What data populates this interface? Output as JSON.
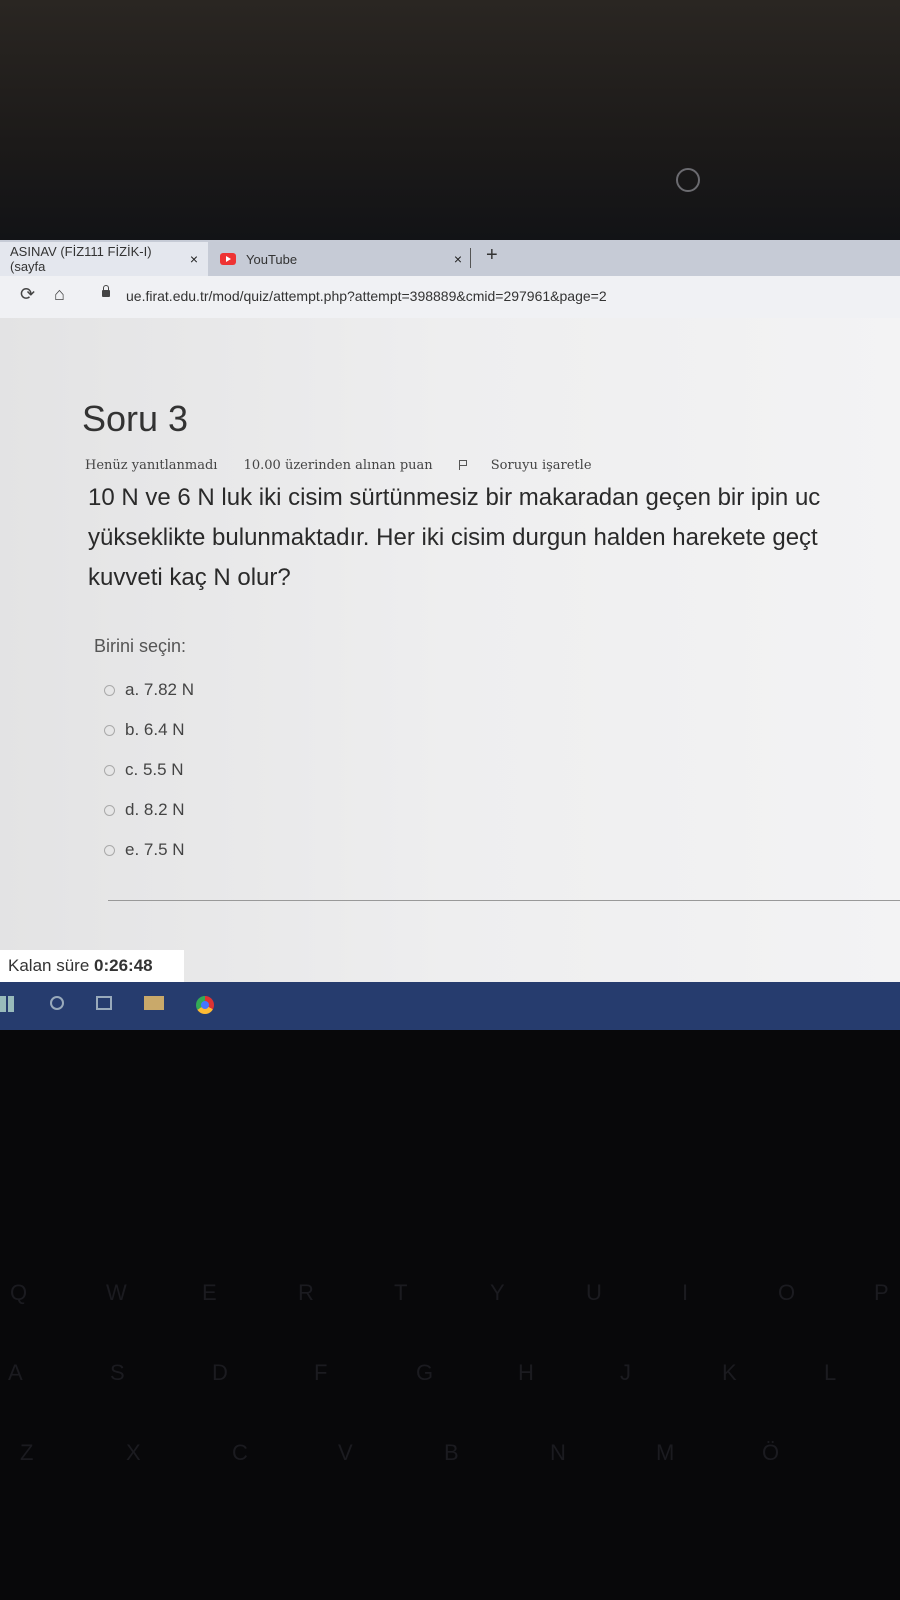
{
  "browser": {
    "tabs": [
      {
        "title": "ASINAV (FİZ111 FİZİK-I) (sayfa",
        "close": "×"
      },
      {
        "title": "YouTube",
        "close": "×"
      }
    ],
    "new_tab": "+",
    "url": "ue.firat.edu.tr/mod/quiz/attempt.php?attempt=398889&cmid=297961&page=2"
  },
  "question": {
    "title": "Soru 3",
    "status": "Henüz yanıtlanmadı",
    "points": "10.00 üzerinden alınan puan",
    "flag_label": "Soruyu işaretle",
    "text_lines": [
      "10 N ve 6 N luk iki cisim sürtünmesiz bir makaradan geçen bir ipin uc",
      "yükseklikte bulunmaktadır. Her iki cisim durgun halden harekete geçt",
      "kuvveti kaç N olur?"
    ],
    "prompt": "Birini seçin:",
    "options": [
      "a. 7.82 N",
      "b. 6.4 N",
      "c. 5.5 N",
      "d. 8.2 N",
      "e. 7.5 N"
    ]
  },
  "timer": {
    "label": "Kalan süre",
    "value": "0:26:48"
  },
  "keyboard": {
    "row1": [
      "Q",
      "W",
      "E",
      "R",
      "T",
      "Y",
      "U",
      "I",
      "O",
      "P"
    ],
    "row2": [
      "A",
      "S",
      "D",
      "F",
      "G",
      "H",
      "J",
      "K",
      "L"
    ],
    "row3": [
      "Z",
      "X",
      "C",
      "V",
      "B",
      "N",
      "M",
      "Ö"
    ]
  }
}
